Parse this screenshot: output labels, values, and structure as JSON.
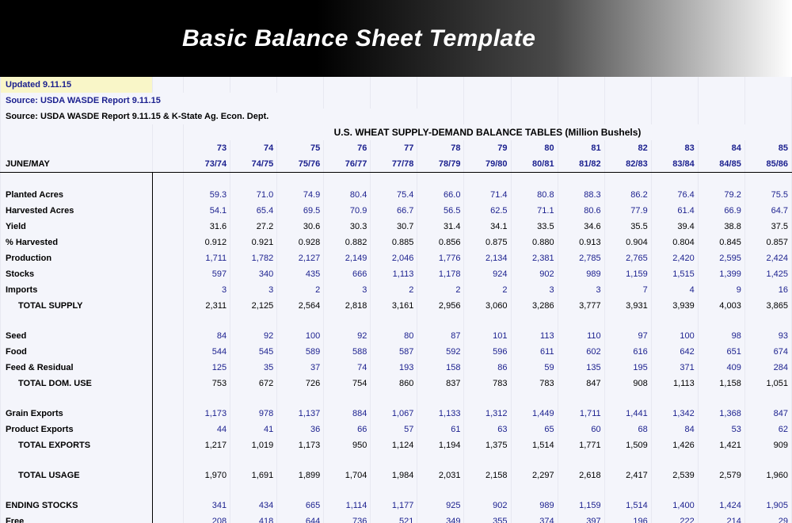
{
  "hero": {
    "title": "Basic Balance Sheet Template"
  },
  "meta": {
    "updated": "Updated 9.11.15",
    "source1": "Source:  USDA WASDE Report 9.11.15",
    "source2": "Source:  USDA WASDE Report 9.11.15 & K-State Ag. Econ. Dept.",
    "table_title": "U.S. WHEAT SUPPLY-DEMAND BALANCE TABLES (Million Bushels)",
    "row_heading": "JUNE/MAY"
  },
  "years": [
    "73",
    "74",
    "75",
    "76",
    "77",
    "78",
    "79",
    "80",
    "81",
    "82",
    "83",
    "84",
    "85"
  ],
  "year_spans": [
    "73/74",
    "74/75",
    "75/76",
    "76/77",
    "77/78",
    "78/79",
    "79/80",
    "80/81",
    "81/82",
    "82/83",
    "83/84",
    "84/85",
    "85/86"
  ],
  "rows": {
    "planted": {
      "label": "Planted Acres",
      "vals": [
        "59.3",
        "71.0",
        "74.9",
        "80.4",
        "75.4",
        "66.0",
        "71.4",
        "80.8",
        "88.3",
        "86.2",
        "76.4",
        "79.2",
        "75.5"
      ],
      "color": "blue"
    },
    "harvested": {
      "label": "Harvested Acres",
      "vals": [
        "54.1",
        "65.4",
        "69.5",
        "70.9",
        "66.7",
        "56.5",
        "62.5",
        "71.1",
        "80.6",
        "77.9",
        "61.4",
        "66.9",
        "64.7"
      ],
      "color": "blue"
    },
    "yield": {
      "label": "Yield",
      "vals": [
        "31.6",
        "27.2",
        "30.6",
        "30.3",
        "30.7",
        "31.4",
        "34.1",
        "33.5",
        "34.6",
        "35.5",
        "39.4",
        "38.8",
        "37.5"
      ],
      "color": "black"
    },
    "pct_harv": {
      "label": "% Harvested",
      "vals": [
        "0.912",
        "0.921",
        "0.928",
        "0.882",
        "0.885",
        "0.856",
        "0.875",
        "0.880",
        "0.913",
        "0.904",
        "0.804",
        "0.845",
        "0.857"
      ],
      "color": "black"
    },
    "production": {
      "label": "Production",
      "vals": [
        "1,711",
        "1,782",
        "2,127",
        "2,149",
        "2,046",
        "1,776",
        "2,134",
        "2,381",
        "2,785",
        "2,765",
        "2,420",
        "2,595",
        "2,424"
      ],
      "color": "blue"
    },
    "stocks": {
      "label": "Stocks",
      "vals": [
        "597",
        "340",
        "435",
        "666",
        "1,113",
        "1,178",
        "924",
        "902",
        "989",
        "1,159",
        "1,515",
        "1,399",
        "1,425"
      ],
      "color": "blue"
    },
    "imports": {
      "label": "Imports",
      "vals": [
        "3",
        "3",
        "2",
        "3",
        "2",
        "2",
        "2",
        "3",
        "3",
        "7",
        "4",
        "9",
        "16"
      ],
      "color": "blue"
    },
    "total_supply": {
      "label": "TOTAL SUPPLY",
      "vals": [
        "2,311",
        "2,125",
        "2,564",
        "2,818",
        "3,161",
        "2,956",
        "3,060",
        "3,286",
        "3,777",
        "3,931",
        "3,939",
        "4,003",
        "3,865"
      ],
      "color": "black",
      "indent": true
    },
    "seed": {
      "label": "Seed",
      "vals": [
        "84",
        "92",
        "100",
        "92",
        "80",
        "87",
        "101",
        "113",
        "110",
        "97",
        "100",
        "98",
        "93"
      ],
      "color": "blue"
    },
    "food": {
      "label": "Food",
      "vals": [
        "544",
        "545",
        "589",
        "588",
        "587",
        "592",
        "596",
        "611",
        "602",
        "616",
        "642",
        "651",
        "674"
      ],
      "color": "blue"
    },
    "feed": {
      "label": "Feed & Residual",
      "vals": [
        "125",
        "35",
        "37",
        "74",
        "193",
        "158",
        "86",
        "59",
        "135",
        "195",
        "371",
        "409",
        "284"
      ],
      "color": "blue"
    },
    "total_dom": {
      "label": "TOTAL DOM. USE",
      "vals": [
        "753",
        "672",
        "726",
        "754",
        "860",
        "837",
        "783",
        "783",
        "847",
        "908",
        "1,113",
        "1,158",
        "1,051"
      ],
      "color": "black",
      "indent": true
    },
    "grain_exp": {
      "label": "Grain Exports",
      "vals": [
        "1,173",
        "978",
        "1,137",
        "884",
        "1,067",
        "1,133",
        "1,312",
        "1,449",
        "1,711",
        "1,441",
        "1,342",
        "1,368",
        "847"
      ],
      "color": "blue"
    },
    "product_exp": {
      "label": "Product Exports",
      "vals": [
        "44",
        "41",
        "36",
        "66",
        "57",
        "61",
        "63",
        "65",
        "60",
        "68",
        "84",
        "53",
        "62"
      ],
      "color": "blue"
    },
    "total_exp": {
      "label": "TOTAL EXPORTS",
      "vals": [
        "1,217",
        "1,019",
        "1,173",
        "950",
        "1,124",
        "1,194",
        "1,375",
        "1,514",
        "1,771",
        "1,509",
        "1,426",
        "1,421",
        "909"
      ],
      "color": "black",
      "indent": true
    },
    "total_usage": {
      "label": "TOTAL USAGE",
      "vals": [
        "1,970",
        "1,691",
        "1,899",
        "1,704",
        "1,984",
        "2,031",
        "2,158",
        "2,297",
        "2,618",
        "2,417",
        "2,539",
        "2,579",
        "1,960"
      ],
      "color": "black",
      "indent": true
    },
    "ending": {
      "label": "ENDING STOCKS",
      "vals": [
        "341",
        "434",
        "665",
        "1,114",
        "1,177",
        "925",
        "902",
        "989",
        "1,159",
        "1,514",
        "1,400",
        "1,424",
        "1,905"
      ],
      "color": "blue"
    },
    "free": {
      "label": "Free",
      "vals": [
        "208",
        "418",
        "644",
        "736",
        "521",
        "349",
        "355",
        "374",
        "397",
        "196",
        "222",
        "214",
        "29"
      ],
      "color": "blue"
    }
  },
  "chart_data": {
    "type": "table",
    "title": "U.S. WHEAT SUPPLY-DEMAND BALANCE TABLES (Million Bushels)",
    "columns": [
      "73/74",
      "74/75",
      "75/76",
      "76/77",
      "77/78",
      "78/79",
      "79/80",
      "80/81",
      "81/82",
      "82/83",
      "83/84",
      "84/85",
      "85/86"
    ],
    "series": [
      {
        "name": "Planted Acres",
        "values": [
          59.3,
          71.0,
          74.9,
          80.4,
          75.4,
          66.0,
          71.4,
          80.8,
          88.3,
          86.2,
          76.4,
          79.2,
          75.5
        ]
      },
      {
        "name": "Harvested Acres",
        "values": [
          54.1,
          65.4,
          69.5,
          70.9,
          66.7,
          56.5,
          62.5,
          71.1,
          80.6,
          77.9,
          61.4,
          66.9,
          64.7
        ]
      },
      {
        "name": "Yield",
        "values": [
          31.6,
          27.2,
          30.6,
          30.3,
          30.7,
          31.4,
          34.1,
          33.5,
          34.6,
          35.5,
          39.4,
          38.8,
          37.5
        ]
      },
      {
        "name": "% Harvested",
        "values": [
          0.912,
          0.921,
          0.928,
          0.882,
          0.885,
          0.856,
          0.875,
          0.88,
          0.913,
          0.904,
          0.804,
          0.845,
          0.857
        ]
      },
      {
        "name": "Production",
        "values": [
          1711,
          1782,
          2127,
          2149,
          2046,
          1776,
          2134,
          2381,
          2785,
          2765,
          2420,
          2595,
          2424
        ]
      },
      {
        "name": "Stocks",
        "values": [
          597,
          340,
          435,
          666,
          1113,
          1178,
          924,
          902,
          989,
          1159,
          1515,
          1399,
          1425
        ]
      },
      {
        "name": "Imports",
        "values": [
          3,
          3,
          2,
          3,
          2,
          2,
          2,
          3,
          3,
          7,
          4,
          9,
          16
        ]
      },
      {
        "name": "TOTAL SUPPLY",
        "values": [
          2311,
          2125,
          2564,
          2818,
          3161,
          2956,
          3060,
          3286,
          3777,
          3931,
          3939,
          4003,
          3865
        ]
      },
      {
        "name": "Seed",
        "values": [
          84,
          92,
          100,
          92,
          80,
          87,
          101,
          113,
          110,
          97,
          100,
          98,
          93
        ]
      },
      {
        "name": "Food",
        "values": [
          544,
          545,
          589,
          588,
          587,
          592,
          596,
          611,
          602,
          616,
          642,
          651,
          674
        ]
      },
      {
        "name": "Feed & Residual",
        "values": [
          125,
          35,
          37,
          74,
          193,
          158,
          86,
          59,
          135,
          195,
          371,
          409,
          284
        ]
      },
      {
        "name": "TOTAL DOM. USE",
        "values": [
          753,
          672,
          726,
          754,
          860,
          837,
          783,
          783,
          847,
          908,
          1113,
          1158,
          1051
        ]
      },
      {
        "name": "Grain Exports",
        "values": [
          1173,
          978,
          1137,
          884,
          1067,
          1133,
          1312,
          1449,
          1711,
          1441,
          1342,
          1368,
          847
        ]
      },
      {
        "name": "Product Exports",
        "values": [
          44,
          41,
          36,
          66,
          57,
          61,
          63,
          65,
          60,
          68,
          84,
          53,
          62
        ]
      },
      {
        "name": "TOTAL EXPORTS",
        "values": [
          1217,
          1019,
          1173,
          950,
          1124,
          1194,
          1375,
          1514,
          1771,
          1509,
          1426,
          1421,
          909
        ]
      },
      {
        "name": "TOTAL USAGE",
        "values": [
          1970,
          1691,
          1899,
          1704,
          1984,
          2031,
          2158,
          2297,
          2618,
          2417,
          2539,
          2579,
          1960
        ]
      },
      {
        "name": "ENDING STOCKS",
        "values": [
          341,
          434,
          665,
          1114,
          1177,
          925,
          902,
          989,
          1159,
          1514,
          1400,
          1424,
          1905
        ]
      },
      {
        "name": "Free",
        "values": [
          208,
          418,
          644,
          736,
          521,
          349,
          355,
          374,
          397,
          196,
          222,
          214,
          29
        ]
      }
    ]
  }
}
